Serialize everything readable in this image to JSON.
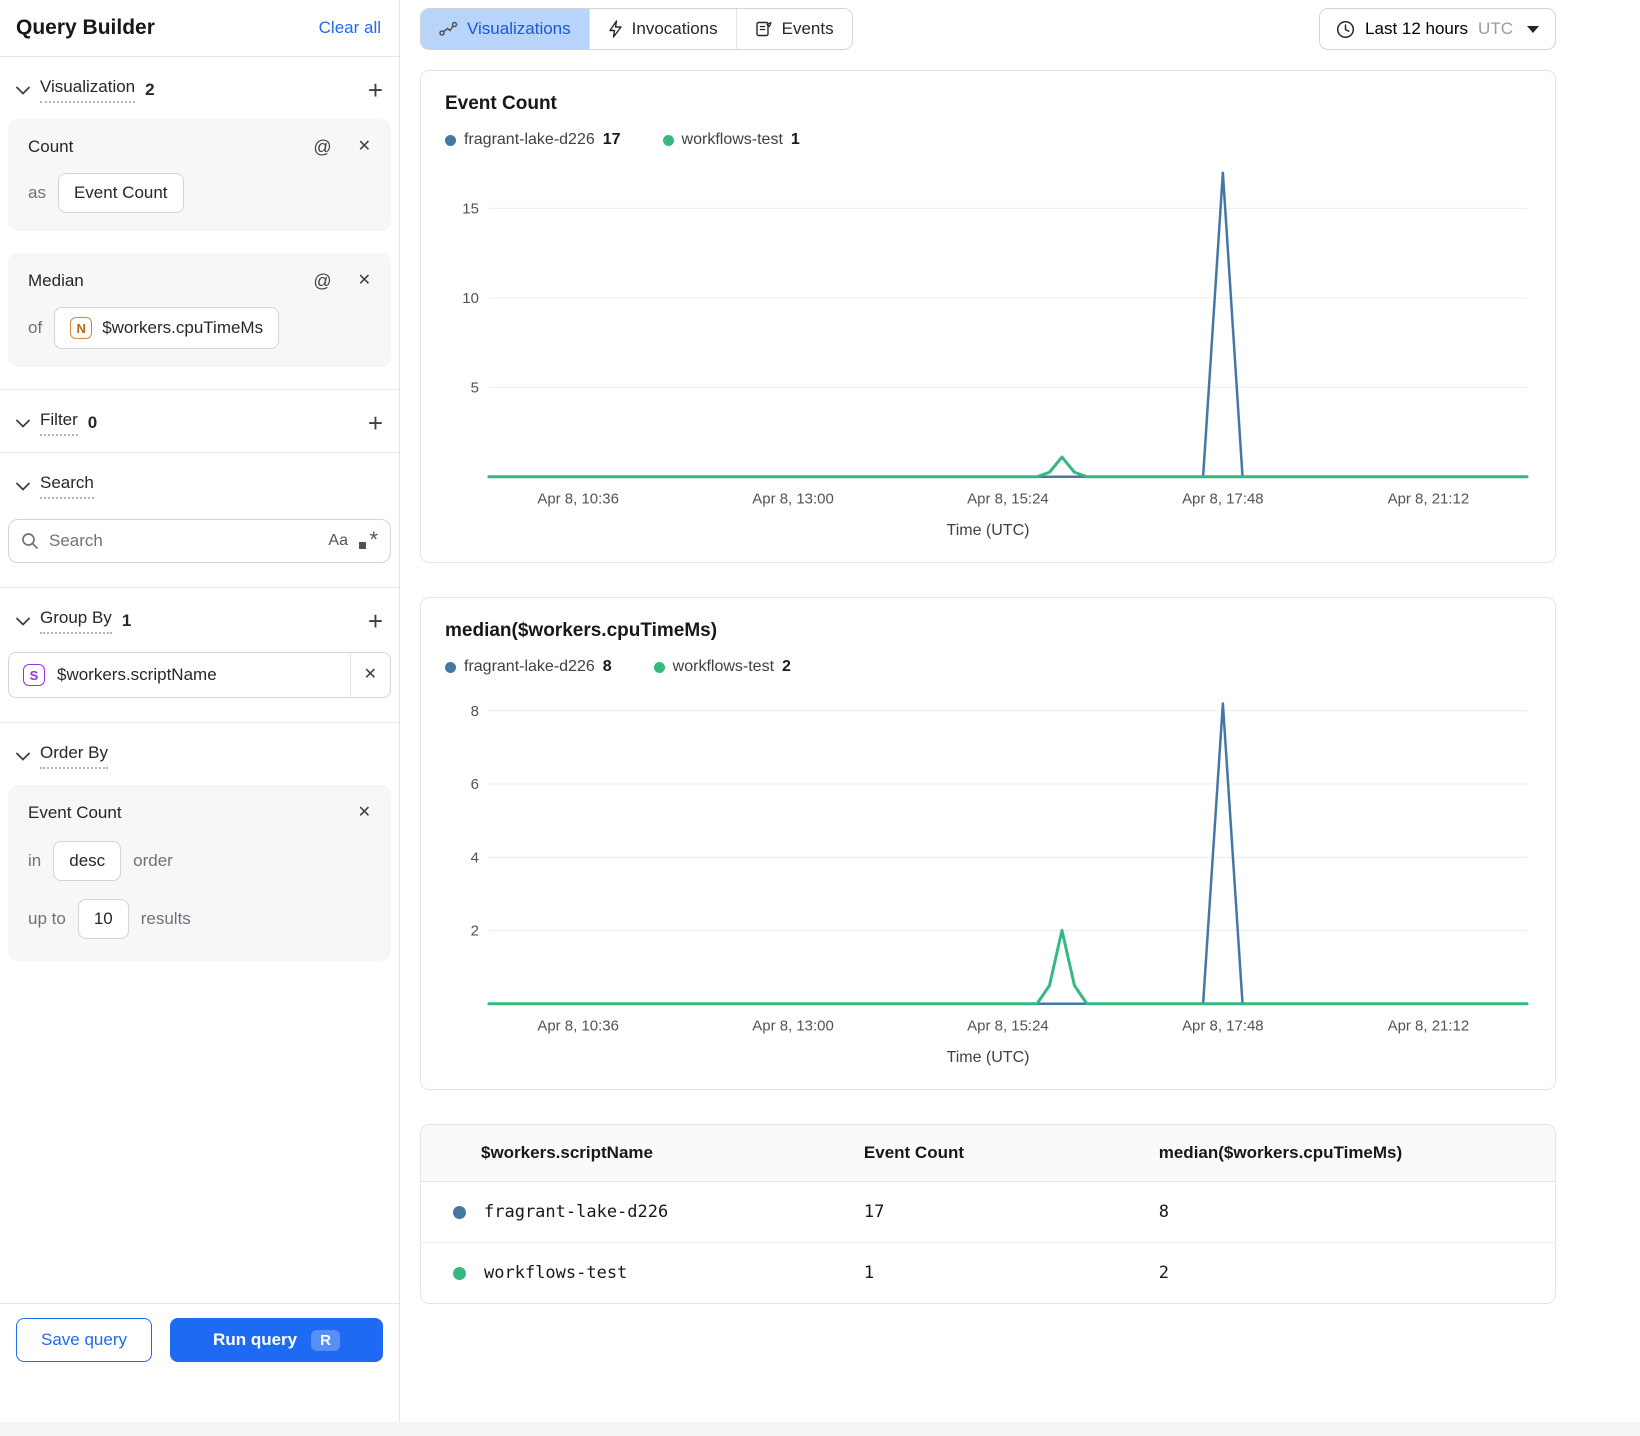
{
  "sidebar": {
    "title": "Query Builder",
    "clear_all": "Clear all",
    "visualization": {
      "label": "Visualization",
      "count": "2",
      "cards": [
        {
          "title": "Count",
          "prefix": "as",
          "value": "Event Count"
        },
        {
          "title": "Median",
          "prefix": "of",
          "value": "$workers.cpuTimeMs",
          "value_type_icon": "N"
        }
      ]
    },
    "filter": {
      "label": "Filter",
      "count": "0"
    },
    "search": {
      "label": "Search",
      "placeholder": "Search",
      "match_case_icon": "Aa",
      "regex_icon": ".*"
    },
    "group_by": {
      "label": "Group By",
      "count": "1",
      "items": [
        {
          "type_icon": "S",
          "value": "$workers.scriptName"
        }
      ]
    },
    "order_by": {
      "label": "Order By",
      "field": "Event Count",
      "in_label": "in",
      "direction": "desc",
      "order_label": "order",
      "up_to_label": "up to",
      "limit": "10",
      "results_label": "results"
    },
    "save_button": "Save query",
    "run_button": "Run query",
    "run_shortcut": "R"
  },
  "topbar": {
    "tabs": [
      {
        "label": "Visualizations",
        "icon": "line-chart-icon",
        "active": true
      },
      {
        "label": "Invocations",
        "icon": "lightning-icon",
        "active": false
      },
      {
        "label": "Events",
        "icon": "events-doc-icon",
        "active": false
      }
    ],
    "time_range": {
      "label": "Last 12 hours",
      "timezone": "UTC"
    }
  },
  "colors": {
    "series_blue": "#4577a5",
    "series_green": "#35b981",
    "accent_blue": "#1f6af2",
    "active_tab_bg": "#b9d4fb",
    "active_tab_text": "#1a56db"
  },
  "chart_data": [
    {
      "type": "line",
      "title": "Event Count",
      "xlabel": "Time (UTC)",
      "x_ticks": [
        "Apr 8, 10:36",
        "Apr 8, 13:00",
        "Apr 8, 15:24",
        "Apr 8, 17:48",
        "Apr 8, 21:12"
      ],
      "x_tick_pos": [
        0.086,
        0.293,
        0.5,
        0.707,
        0.905
      ],
      "y_ticks": [
        5,
        10,
        15
      ],
      "ylim": [
        0,
        17.3
      ],
      "grid": true,
      "legend": [
        {
          "name": "fragrant-lake-d226",
          "value": "17",
          "color": "#4577a5"
        },
        {
          "name": "workflows-test",
          "value": "1",
          "color": "#35b981"
        }
      ],
      "series": [
        {
          "name": "fragrant-lake-d226",
          "color": "#4577a5",
          "width": 2.5,
          "points": [
            [
              0,
              0
            ],
            [
              0.688,
              0
            ],
            [
              0.707,
              17
            ],
            [
              0.726,
              0
            ],
            [
              1,
              0
            ]
          ]
        },
        {
          "name": "workflows-test",
          "color": "#35b981",
          "width": 3,
          "points": [
            [
              0,
              0
            ],
            [
              0.528,
              0
            ],
            [
              0.54,
              0.25
            ],
            [
              0.552,
              1.1
            ],
            [
              0.564,
              0.25
            ],
            [
              0.576,
              0
            ],
            [
              1,
              0
            ]
          ]
        }
      ]
    },
    {
      "type": "line",
      "title": "median($workers.cpuTimeMs)",
      "xlabel": "Time (UTC)",
      "x_ticks": [
        "Apr 8, 10:36",
        "Apr 8, 13:00",
        "Apr 8, 15:24",
        "Apr 8, 17:48",
        "Apr 8, 21:12"
      ],
      "x_tick_pos": [
        0.086,
        0.293,
        0.5,
        0.707,
        0.905
      ],
      "y_ticks": [
        2,
        4,
        6,
        8
      ],
      "ylim": [
        0,
        8.45
      ],
      "grid": true,
      "legend": [
        {
          "name": "fragrant-lake-d226",
          "value": "8",
          "color": "#4577a5"
        },
        {
          "name": "workflows-test",
          "value": "2",
          "color": "#35b981"
        }
      ],
      "series": [
        {
          "name": "fragrant-lake-d226",
          "color": "#4577a5",
          "width": 2.5,
          "points": [
            [
              0,
              0
            ],
            [
              0.688,
              0
            ],
            [
              0.707,
              8.2
            ],
            [
              0.726,
              0
            ],
            [
              1,
              0
            ]
          ]
        },
        {
          "name": "workflows-test",
          "color": "#35b981",
          "width": 3,
          "points": [
            [
              0,
              0
            ],
            [
              0.528,
              0
            ],
            [
              0.54,
              0.5
            ],
            [
              0.552,
              2
            ],
            [
              0.564,
              0.5
            ],
            [
              0.576,
              0
            ],
            [
              1,
              0
            ]
          ]
        }
      ]
    }
  ],
  "table": {
    "columns": [
      "$workers.scriptName",
      "Event Count",
      "median($workers.cpuTimeMs)"
    ],
    "rows": [
      {
        "color": "#4577a5",
        "name": "fragrant-lake-d226",
        "event_count": "17",
        "median": "8"
      },
      {
        "color": "#35b981",
        "name": "workflows-test",
        "event_count": "1",
        "median": "2"
      }
    ]
  }
}
